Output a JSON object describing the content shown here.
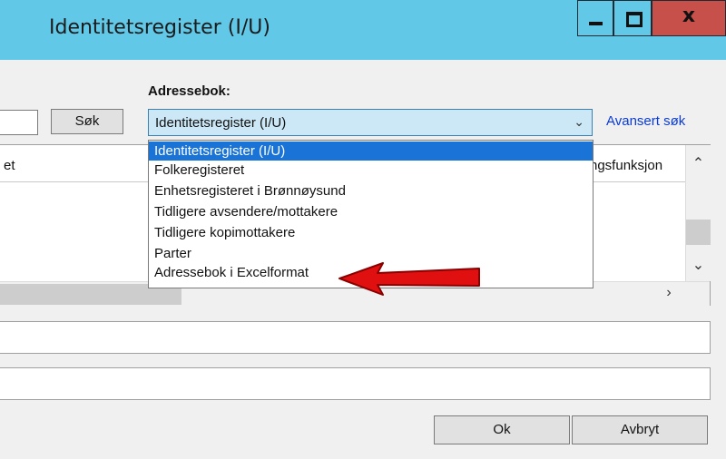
{
  "window": {
    "title": "Identitetsregister (I/U)",
    "controls": {
      "minimize": "−",
      "maximize": "□",
      "close": "x"
    }
  },
  "search": {
    "label": "Adressebok:",
    "search_button": "Søk",
    "address_book_selected": "Identitetsregister (I/U)",
    "advanced_link": "Avansert søk"
  },
  "dropdown": {
    "options": [
      "Identitetsregister (I/U)",
      "Folkeregisteret",
      "Enhetsregisteret i Brønnøysund",
      "Tidligere avsendere/mottakere",
      "Tidligere kopimottakere",
      "Parter",
      "Adressebok i Excelformat"
    ],
    "highlighted_option": "Identitetsregister (I/U)",
    "annotated_option": "Adressebok i Excelformat"
  },
  "grid": {
    "columns": [
      "et",
      "ngsfunksjon"
    ]
  },
  "buttons": {
    "ok": "Ok",
    "cancel": "Avbryt"
  },
  "colors": {
    "titlebar": "#62c8e8",
    "close_button": "#c7504a",
    "selection": "#1a73d6",
    "link": "#0a3bd6",
    "annotation_arrow": "#e01010"
  }
}
